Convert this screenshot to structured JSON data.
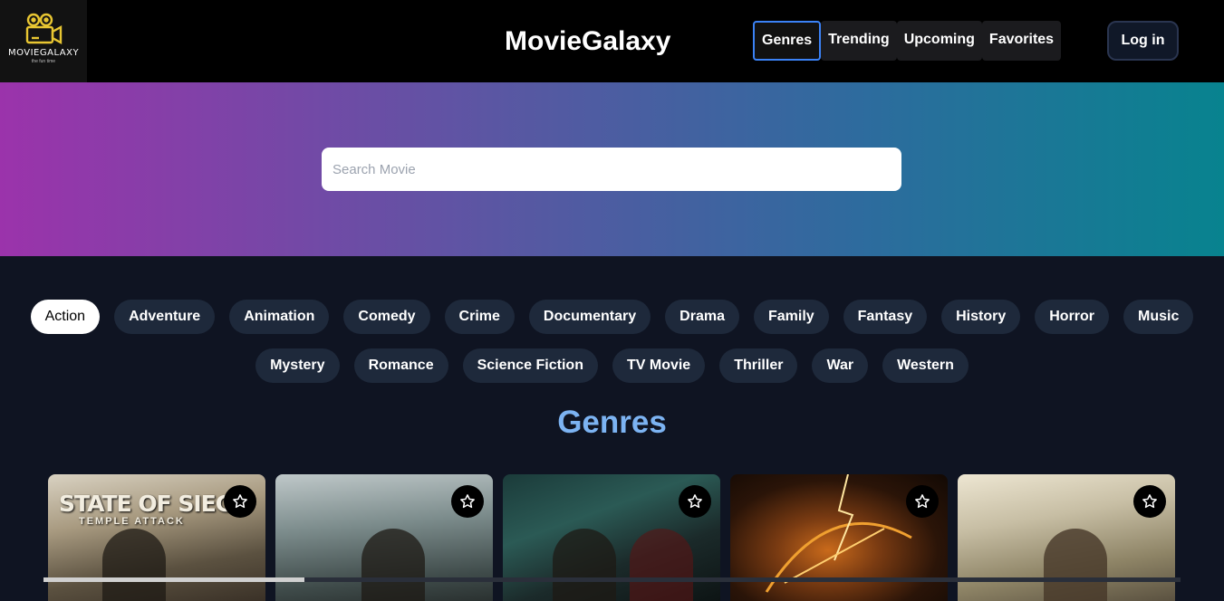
{
  "header": {
    "logo_name": "MOVIEGALAXY",
    "logo_tagline": "the fun time",
    "title": "MovieGalaxy",
    "nav": [
      {
        "label": "Genres",
        "active": true
      },
      {
        "label": "Trending",
        "active": false
      },
      {
        "label": "Upcoming",
        "active": false
      },
      {
        "label": "Favorites",
        "active": false
      }
    ],
    "login_label": "Log in"
  },
  "search": {
    "placeholder": "Search Movie",
    "value": ""
  },
  "genres": {
    "row1": [
      "Action",
      "Adventure",
      "Animation",
      "Comedy",
      "Crime",
      "Documentary",
      "Drama",
      "Family",
      "Fantasy",
      "History",
      "Horror",
      "Music"
    ],
    "row2": [
      "Mystery",
      "Romance",
      "Science Fiction",
      "TV Movie",
      "Thriller",
      "War",
      "Western"
    ],
    "selected": "Action"
  },
  "section_title": "Genres",
  "movies": [
    {
      "poster_text": "STATE OF SIEG",
      "poster_sub": "TEMPLE ATTACK",
      "fav_icon": "star-outline-icon"
    },
    {
      "poster_text": "",
      "poster_sub": "",
      "fav_icon": "star-outline-icon"
    },
    {
      "poster_text": "",
      "poster_sub": "",
      "fav_icon": "star-outline-icon"
    },
    {
      "poster_text": "",
      "poster_sub": "",
      "fav_icon": "star-outline-icon"
    },
    {
      "poster_text": "",
      "poster_sub": "",
      "fav_icon": "star-outline-icon"
    }
  ],
  "colors": {
    "accent_blue": "#3b82f6",
    "section_title": "#7cb3f2",
    "chip_bg": "#1e293b",
    "page_bg": "#0f1422"
  }
}
